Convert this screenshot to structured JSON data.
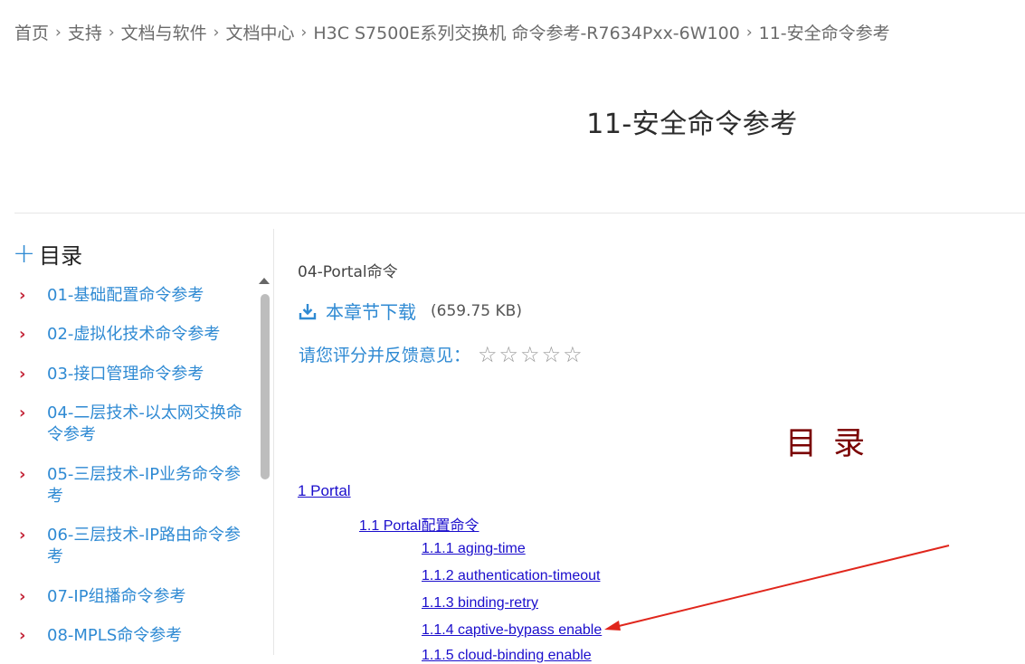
{
  "breadcrumb": [
    "首页",
    "支持",
    "文档与软件",
    "文档中心",
    "H3C S7500E系列交换机 命令参考-R7634Pxx-6W100",
    "11-安全命令参考"
  ],
  "breadcrumb_separator": "›",
  "page_title": "11-安全命令参考",
  "sidebar": {
    "heading_icon": "+",
    "heading": "目录",
    "items": [
      {
        "label": "01-基础配置命令参考"
      },
      {
        "label": "02-虚拟化技术命令参考"
      },
      {
        "label": "03-接口管理命令参考"
      },
      {
        "label": "04-二层技术-以太网交换命令参考"
      },
      {
        "label": "05-三层技术-IP业务命令参考"
      },
      {
        "label": "06-三层技术-IP路由命令参考"
      },
      {
        "label": "07-IP组播命令参考"
      },
      {
        "label": "08-MPLS命令参考"
      }
    ]
  },
  "content": {
    "chapter": "04-Portal命令",
    "download_label": "本章节下载",
    "download_size": "(659.75 KB)",
    "rating_label": "请您评分并反馈意见：",
    "rating_stars": 5,
    "rating_value": 0,
    "toc_title": "目录",
    "toc": [
      {
        "text": "1 Portal",
        "level": 1
      },
      {
        "text": "1.1 Portal配置命令",
        "level": 2
      },
      {
        "text": "1.1.1 aging-time",
        "level": 3
      },
      {
        "text": "1.1.2 authentication-timeout",
        "level": 3
      },
      {
        "text": "1.1.3 binding-retry",
        "level": 3
      },
      {
        "text": "1.1.4 captive-bypass enable",
        "level": 3
      },
      {
        "text": "1.1.5 cloud-binding enable",
        "level": 3
      }
    ]
  },
  "colors": {
    "link": "#2f8ad3",
    "chevron": "#c4273a",
    "toc_link": "#1a0dcc",
    "toc_title": "#7a0000",
    "annotation_arrow": "#e0261c"
  }
}
